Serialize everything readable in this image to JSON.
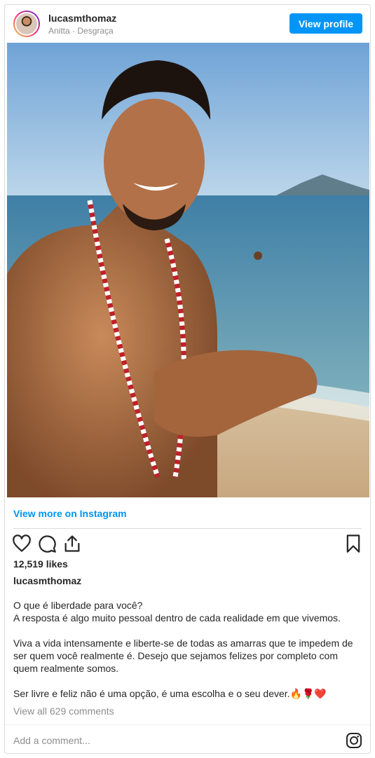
{
  "header": {
    "username": "lucasmthomaz",
    "subtitle": "Anitta · Desgraça",
    "view_profile_label": "View profile"
  },
  "media": {
    "description_icon": "photo"
  },
  "view_more_label": "View more on Instagram",
  "actions": {
    "like_icon": "heart-icon",
    "comment_icon": "comment-icon",
    "share_icon": "share-icon",
    "save_icon": "bookmark-icon"
  },
  "likes": "12,519 likes",
  "owner": "lucasmthomaz",
  "caption": {
    "line1": "O que é liberdade para você?",
    "line2": "A resposta é algo muito pessoal dentro de cada realidade em que vivemos.",
    "para2": "Viva a vida intensamente e liberte-se de todas as amarras que te impedem de ser quem você realmente é. Desejo que sejamos felizes por completo com quem realmente somos.",
    "para3": "Ser livre e feliz não é uma opção, é uma escolha e o seu dever.🔥🌹❤️"
  },
  "comments_link": "View all 629 comments",
  "comment_placeholder": "Add a comment...",
  "colors": {
    "accent": "#0095f6",
    "border": "#dbdbdb",
    "muted": "#8e8e8e"
  }
}
